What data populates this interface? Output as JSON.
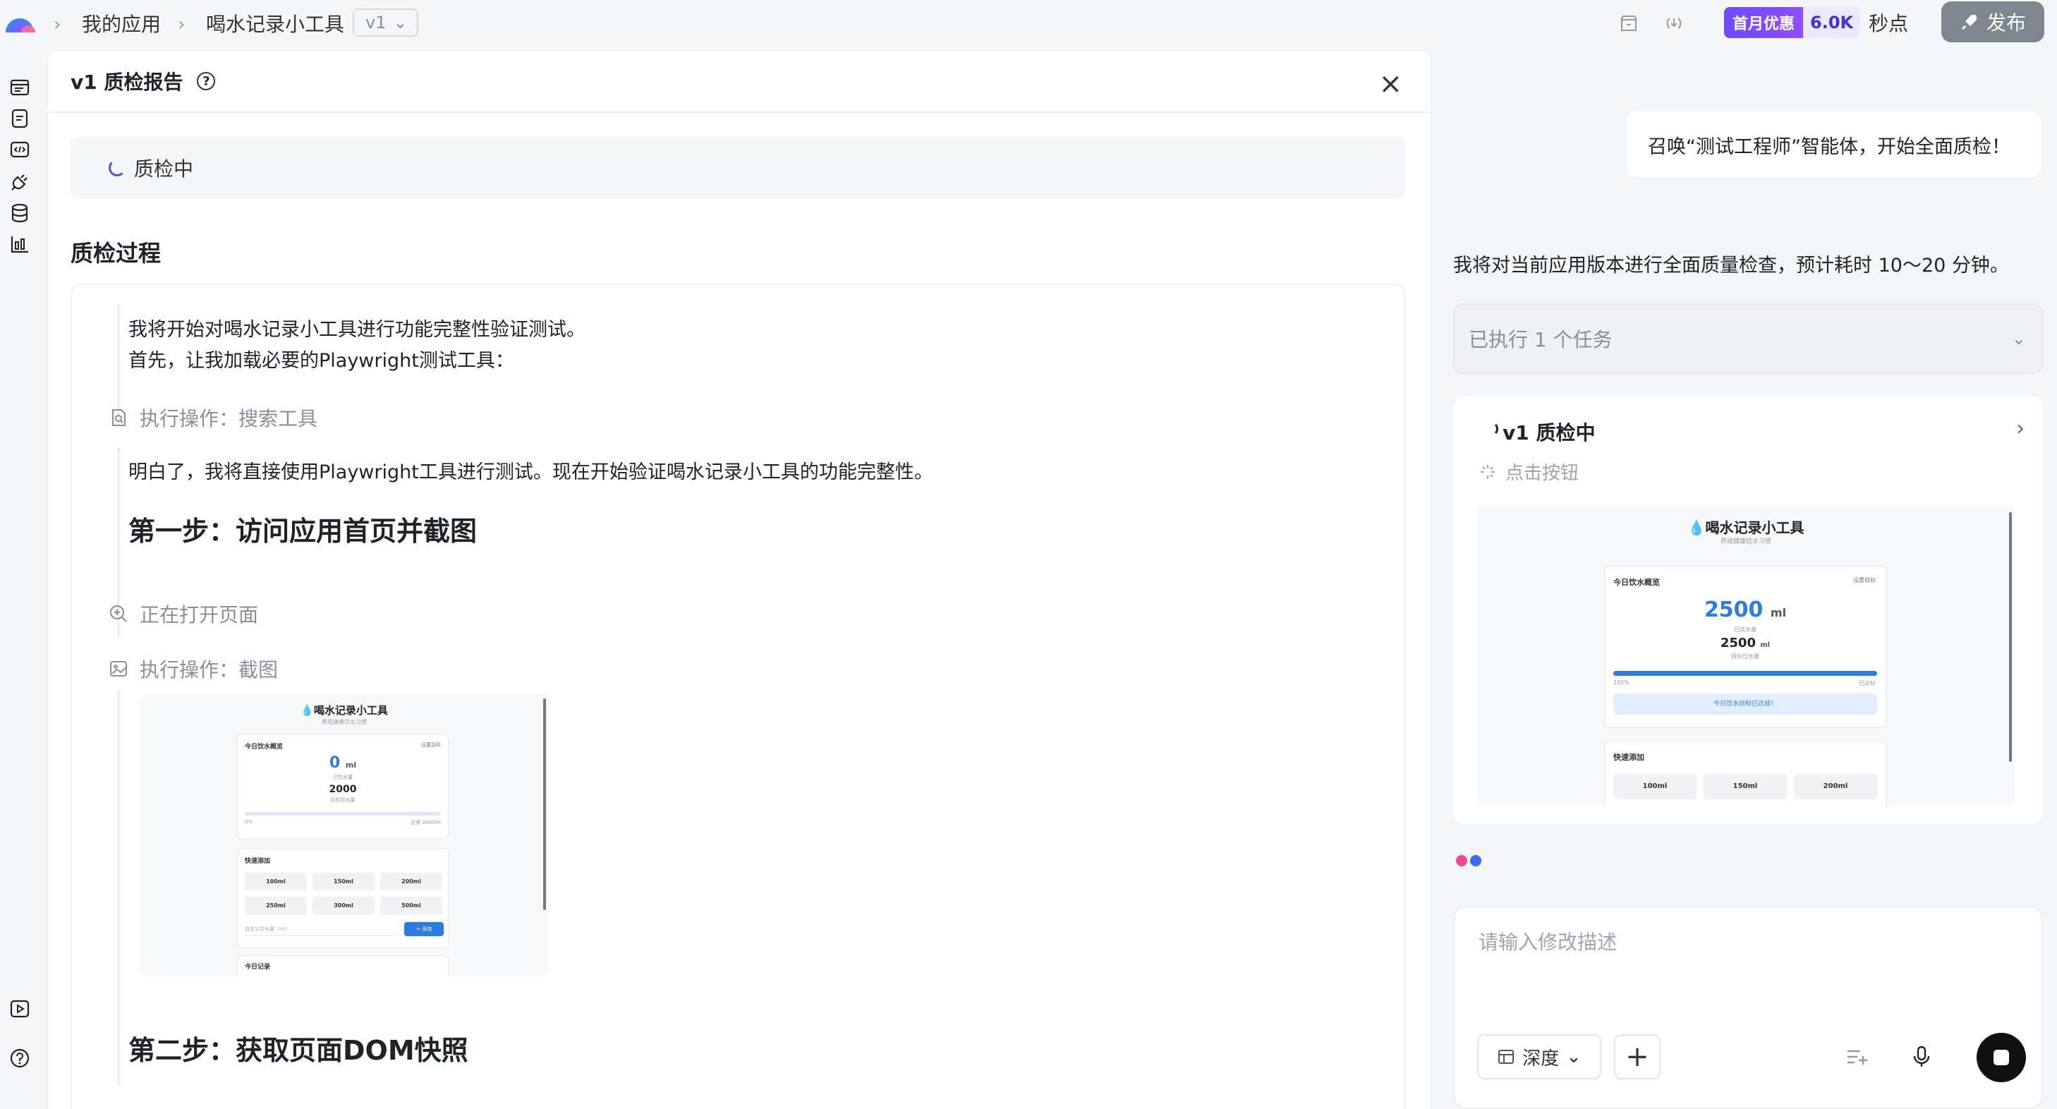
{
  "header": {
    "breadcrumb": [
      "我的应用",
      "喝水记录小工具"
    ],
    "version": "v1",
    "promo_tag": "首月优惠",
    "credits_value": "6.0K",
    "credits_unit": "秒点",
    "publish_label": "发布"
  },
  "sidebar": {
    "icons": [
      "browser-icon",
      "document-icon",
      "code-icon",
      "plug-icon",
      "database-icon",
      "chart-icon",
      "play-icon",
      "help-icon"
    ]
  },
  "report": {
    "title": "v1 质检报告",
    "help": "?",
    "close": "×",
    "status": "质检中",
    "section_title": "质检过程",
    "intro_line1": "我将开始对喝水记录小工具进行功能完整性验证测试。",
    "intro_line2": "首先，让我加载必要的Playwright测试工具：",
    "op_search": "执行操作：搜索工具",
    "msg2": "明白了，我将直接使用Playwright工具进行测试。现在开始验证喝水记录小工具的功能完整性。",
    "step1": "第一步：访问应用首页并截图",
    "op_open": "正在打开页面",
    "op_screenshot": "执行操作：截图",
    "step2": "第二步：获取页面DOM快照"
  },
  "screenshot_small": {
    "app_title": "喝水记录小工具",
    "subtitle": "养成健康饮水习惯",
    "overview": "今日饮水概览",
    "settings": "设置目标",
    "amount": "0",
    "unit": "ml",
    "drunk_label": "已饮水量",
    "goal": "2000",
    "goal_label": "目标饮水量",
    "pct": "0%",
    "remaining": "还需 2000ml",
    "progress": 0,
    "quick_add": "快速添加",
    "buttons": [
      "100ml",
      "150ml",
      "200ml",
      "250ml",
      "300ml",
      "500ml"
    ],
    "custom_placeholder": "自定义饮水量（ml）",
    "add_btn": "+ 添加",
    "today_records": "今日记录"
  },
  "chat": {
    "user_msg": "召唤“测试工程师”智能体，开始全面质检！",
    "assistant_msg": "我将对当前应用版本进行全面质量检查，预计耗时 10～20 分钟。",
    "tasks": "已执行 1 个任务",
    "qc_title": "v1 质检中",
    "qc_action": "点击按钮"
  },
  "screenshot_large": {
    "app_title": "喝水记录小工具",
    "subtitle": "养成健康饮水习惯",
    "overview": "今日饮水概览",
    "settings": "设置目标",
    "amount": "2500",
    "unit": "ml",
    "drunk_label": "已饮水量",
    "goal": "2500",
    "goal_label": "目标饮水量",
    "pct": "100%",
    "done": "已达标",
    "progress": 1,
    "goal_reached": "今日饮水目标已达成！",
    "quick_add": "快速添加",
    "buttons": [
      "100ml",
      "150ml",
      "200ml"
    ]
  },
  "composer": {
    "placeholder": "请输入修改描述",
    "mode": "深度",
    "plus": "+"
  },
  "colors": {
    "accent": "#3c5ae6",
    "promo": "#6d4bff",
    "dot_pink": "#f04a8c",
    "dot_blue": "#3f6af0"
  }
}
